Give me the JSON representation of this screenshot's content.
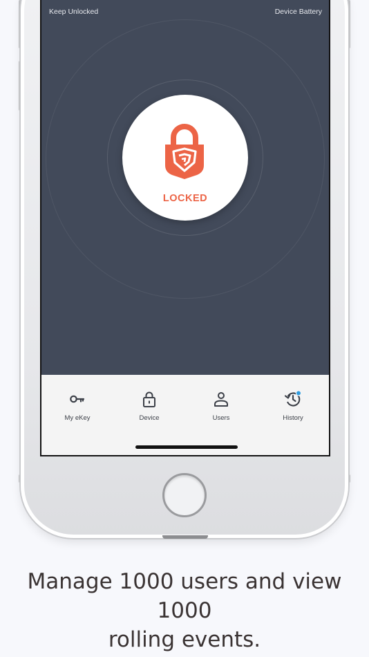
{
  "status_bar": {
    "left_label": "Keep Unlocked",
    "right_label": "Device Battery"
  },
  "lock": {
    "status": "LOCKED",
    "icon": "padlock-shield-icon",
    "accent_color": "#ec6446"
  },
  "colors": {
    "screen_background": "#424a5a",
    "tab_background": "#f4f4f4",
    "notification_dot": "#2e9cdf"
  },
  "tabs": [
    {
      "label": "My eKey",
      "icon": "key-icon"
    },
    {
      "label": "Device",
      "icon": "lock-icon"
    },
    {
      "label": "Users",
      "icon": "user-icon"
    },
    {
      "label": "History",
      "icon": "history-icon"
    }
  ],
  "caption": {
    "line1": "Manage 1000 users and view 1000",
    "line2": "rolling events."
  }
}
